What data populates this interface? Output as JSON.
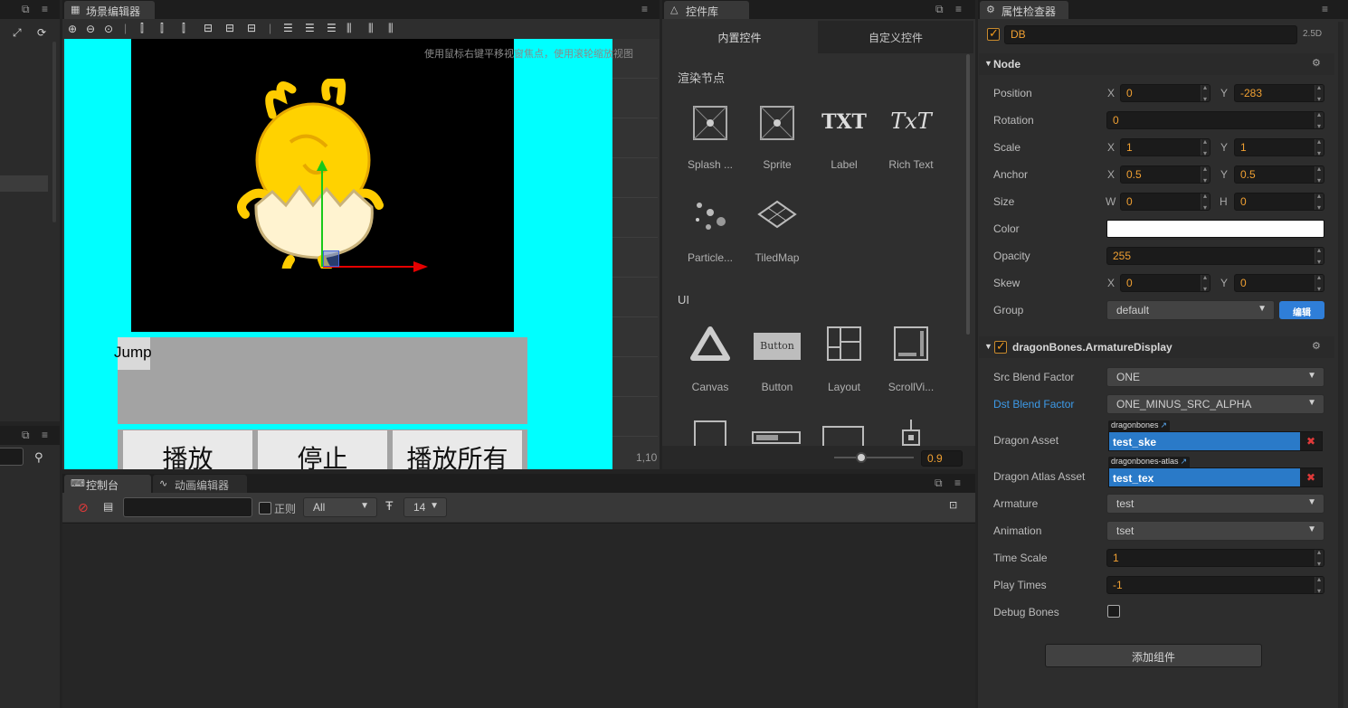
{
  "scene_editor": {
    "tab": "场景编辑器",
    "hint": "使用鼠标右键平移视窗焦点，使用滚轮缩放视图",
    "coord": "1,10",
    "jump_label": "Jump",
    "buttons": [
      "播放",
      "停止",
      "播放所有"
    ]
  },
  "widget_lib": {
    "tab": "控件库",
    "subtabs": [
      "内置控件",
      "自定义控件"
    ],
    "section_render": "渲染节点",
    "section_ui": "UI",
    "render_items": [
      "Splash ...",
      "Sprite",
      "Label",
      "Rich Text",
      "Particle...",
      "TiledMap"
    ],
    "render_icons": [
      "splash-icon",
      "sprite-icon",
      "label-icon",
      "richtext-icon",
      "particle-icon",
      "tiledmap-icon"
    ],
    "label_icon_text": "TXT",
    "richtext_icon_text": "TxT",
    "button_icon_text": "Button",
    "ui_items": [
      "Canvas",
      "Button",
      "Layout",
      "ScrollVi..."
    ],
    "zoom_value": "0.9"
  },
  "console": {
    "tabs": [
      "控制台",
      "动画编辑器"
    ],
    "regex_label": "正则",
    "level_select": "All",
    "font_size": "14"
  },
  "inspector": {
    "tab": "属性检查器",
    "node_name": "DB",
    "mode": "2.5D",
    "node_section": "Node",
    "position_label": "Position",
    "position_x": "0",
    "position_y": "-283",
    "rotation_label": "Rotation",
    "rotation": "0",
    "scale_label": "Scale",
    "scale_x": "1",
    "scale_y": "1",
    "anchor_label": "Anchor",
    "anchor_x": "0.5",
    "anchor_y": "0.5",
    "size_label": "Size",
    "size_w": "0",
    "size_h": "0",
    "color_label": "Color",
    "color_value": "#ffffff",
    "opacity_label": "Opacity",
    "opacity": "255",
    "skew_label": "Skew",
    "skew_x": "0",
    "skew_y": "0",
    "group_label": "Group",
    "group": "default",
    "edit_button": "编辑",
    "axis_x": "X",
    "axis_y": "Y",
    "axis_w": "W",
    "axis_h": "H",
    "component": "dragonBones.ArmatureDisplay",
    "src_blend_label": "Src Blend Factor",
    "src_blend": "ONE",
    "dst_blend_label": "Dst Blend Factor",
    "dst_blend": "ONE_MINUS_SRC_ALPHA",
    "dragon_asset_label": "Dragon Asset",
    "dragon_asset_tag": "dragonbones",
    "dragon_asset": "test_ske",
    "atlas_asset_label": "Dragon Atlas Asset",
    "atlas_asset_tag": "dragonbones-atlas",
    "atlas_asset": "test_tex",
    "armature_label": "Armature",
    "armature": "test",
    "animation_label": "Animation",
    "animation": "tset",
    "timescale_label": "Time Scale",
    "timescale": "1",
    "playtimes_label": "Play Times",
    "playtimes": "-1",
    "debug_label": "Debug Bones",
    "add_component": "添加组件"
  }
}
